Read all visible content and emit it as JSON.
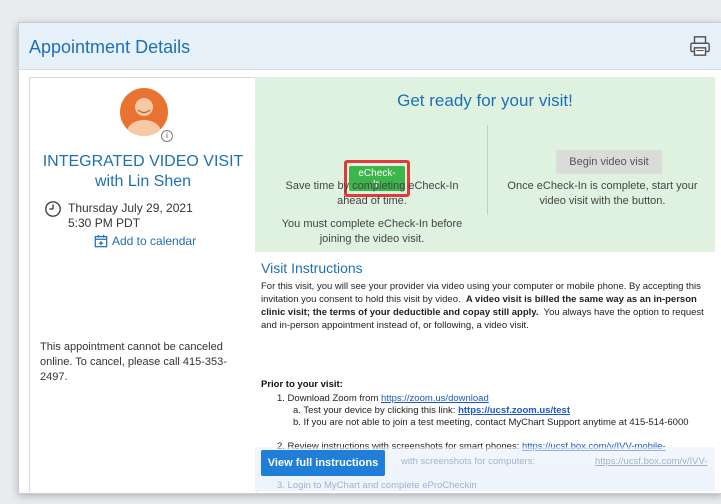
{
  "header": {
    "title": "Appointment Details",
    "print_icon": "printer-icon"
  },
  "left": {
    "avatar_icon": "provider-avatar",
    "visit_name": "INTEGRATED VIDEO VISIT with Lin Shen",
    "date": "Thursday July 29, 2021",
    "time": "5:30 PM PDT",
    "add_to_calendar": "Add to calendar",
    "cancel_note": "This appointment cannot be canceled online. To cancel, please call 415-353-2497."
  },
  "ready": {
    "title": "Get ready for your visit!",
    "echeck_button": "eCheck-In",
    "echeck_text1": "Save time by completing eCheck-In ahead of time.",
    "echeck_text2": "You must complete eCheck-In before joining the video visit.",
    "video_button": "Begin video visit",
    "video_text": "Once eCheck-In is complete, start your video visit with the button."
  },
  "instructions": {
    "title": "Visit Instructions",
    "para_1": "For this visit, you will see your provider via video using your computer or mobile phone.  By accepting this invitation you consent to hold this visit by video.",
    "para_bold": "A video visit is billed the same way as an in-person clinic visit; the terms of your deductible and copay still apply.",
    "para_2": "You always have the option to request and in-person appointment instead of, or following, a video visit.",
    "prior_heading": "Prior to your visit:",
    "step1_text": "1. Download Zoom from",
    "step1_link": "https://zoom.us/download",
    "step1a_text": "a. Test your device by clicking this link:",
    "step1a_link": "https://ucsf.zoom.us/test",
    "step1b_text": "b. If you are not able to join a test meeting, contact MyChart Support anytime at 415-514-6000",
    "step2_text": "2. Review instructions with screenshots for smart phones:",
    "step2_link": "https://ucsf.box.com/v/IVV-mobile-Instructions",
    "step2b_text": "with screenshots for computers:",
    "step2b_link": "https://ucsf.box.com/v/IVV-",
    "step3_text": "3. Login to MyChart and complete eProCheckin",
    "view_full_button": "View full instructions"
  },
  "colors": {
    "accent_blue": "#1f6fb5",
    "green_button": "#3cb54a",
    "highlight_red": "#e23a3a",
    "green_band": "#dff2e0"
  }
}
